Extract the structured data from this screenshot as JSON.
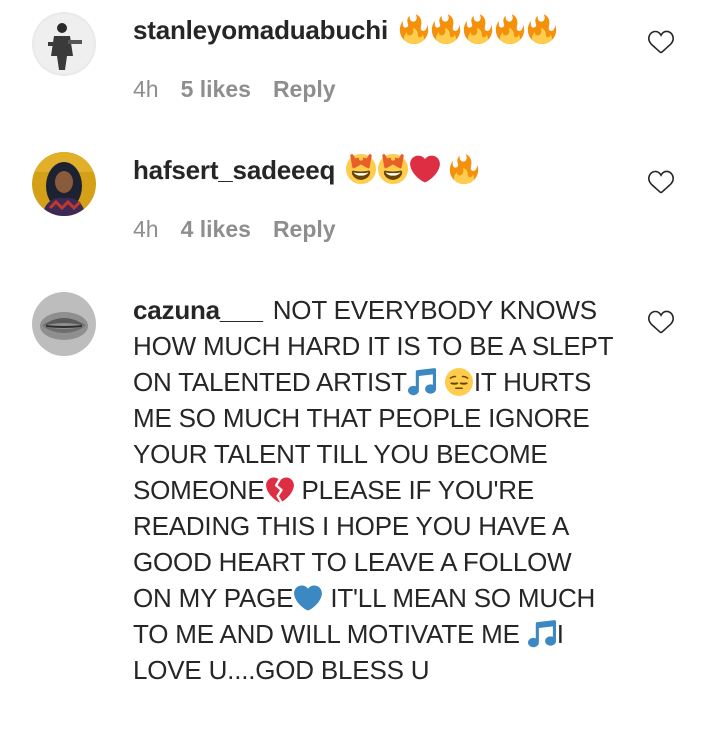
{
  "comments": [
    {
      "username": "stanleyomaduabuchi",
      "text_emojis": [
        "fire-emoji",
        "fire-emoji",
        "fire-emoji",
        "fire-emoji",
        "fire-emoji"
      ],
      "time": "4h",
      "likes": "5 likes",
      "reply": "Reply",
      "avatar_icon": "avatar-photo-person-standing"
    },
    {
      "username": "hafsert_sadeeeq",
      "text_emojis": [
        "heart-eyes-emoji",
        "heart-eyes-emoji",
        "red-heart-emoji",
        "fire-emoji"
      ],
      "time": "4h",
      "likes": "4 likes",
      "reply": "Reply",
      "avatar_icon": "avatar-photo-woman-hijab"
    },
    {
      "username": "cazuna___",
      "text_parts": [
        "NOT EVERYBODY KNOWS HOW MUCH HARD IT IS TO BE A SLEPT ON TALENTED ARTIST",
        "IT HURTS ME SO MUCH THAT PEOPLE IGNORE YOUR TALENT TILL YOU BECOME SOMEONE",
        " PLEASE IF YOU'RE READING THIS I HOPE YOU HAVE A GOOD HEART TO LEAVE A FOLLOW ON MY PAGE",
        " IT'LL MEAN SO MUCH TO ME AND WILL MOTIVATE ME ",
        "I LOVE U....GOD BLESS U"
      ],
      "inline_emojis": [
        "music-notes-emoji",
        "pensive-face-emoji",
        "broken-heart-emoji",
        "blue-heart-emoji",
        "music-notes-emoji"
      ],
      "avatar_icon": "avatar-photo-lips-grayscale"
    }
  ],
  "colors": {
    "text": "#262626",
    "meta": "#8e8e8e",
    "heart_outline": "#262626",
    "fire": "#f4900c",
    "red_heart": "#dd2e44",
    "blue_heart": "#3b88c3",
    "music_notes": "#3b88c3"
  }
}
